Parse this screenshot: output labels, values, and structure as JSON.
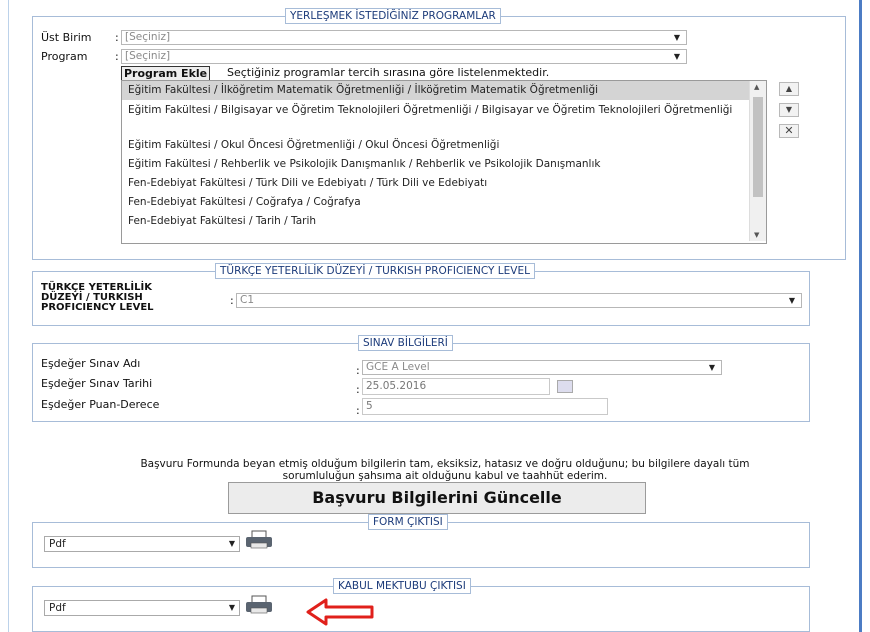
{
  "programs_section": {
    "legend": "YERLEŞMEK İSTEDİĞİNİZ PROGRAMLAR",
    "ust_birim_label": "Üst Birim",
    "ust_birim_value": "[Seçiniz]",
    "program_label": "Program",
    "program_value": "[Seçiniz]",
    "add_button": "Program Ekle",
    "note": "Seçtiğiniz programlar tercih sırasına göre listelenmektedir.",
    "items": [
      "Eğitim Fakültesi / İlköğretim Matematik Öğretmenliği / İlköğretim Matematik Öğretmenliği",
      "Eğitim Fakültesi / Bilgisayar ve Öğretim Teknolojileri Öğretmenliği / Bilgisayar ve Öğretim Teknolojileri Öğretmenliği",
      "Eğitim Fakültesi / Okul Öncesi Öğretmenliği / Okul Öncesi Öğretmenliği",
      "Eğitim Fakültesi / Rehberlik ve Psikolojik Danışmanlık / Rehberlik ve Psikolojik Danışmanlık",
      "Fen-Edebiyat Fakültesi / Türk Dili ve Edebiyatı / Türk Dili ve Edebiyatı",
      "Fen-Edebiyat Fakültesi / Coğrafya / Coğrafya",
      "Fen-Edebiyat Fakültesi / Tarih / Tarih"
    ]
  },
  "turkish_section": {
    "legend": "TÜRKÇE YETERLİLİK DÜZEYİ / TURKISH PROFICIENCY LEVEL",
    "label_line1": "TÜRKÇE YETERLİLİK",
    "label_line2": "DÜZEYİ / TURKISH",
    "label_line3": "PROFICIENCY LEVEL",
    "value": "C1"
  },
  "exam_section": {
    "legend": "SINAV BİLGİLERİ",
    "name_label": "Eşdeğer Sınav Adı",
    "name_value": "GCE A Level",
    "date_label": "Eşdeğer Sınav Tarihi",
    "date_value": "25.05.2016",
    "score_label": "Eşdeğer Puan-Derece",
    "score_value": "5"
  },
  "declaration": {
    "line1": "Başvuru Formunda beyan etmiş olduğum bilgilerin tam, eksiksiz, hatasız ve doğru olduğunu; bu bilgilere dayalı tüm",
    "line2": "sorumluluğun şahsıma ait olduğunu kabul ve taahhüt ederim.",
    "update_button": "Başvuru Bilgilerini Güncelle"
  },
  "form_output": {
    "legend": "FORM ÇIKTISI",
    "format": "Pdf"
  },
  "acceptance_output": {
    "legend": "KABUL MEKTUBU ÇIKTISI",
    "format": "Pdf"
  },
  "colors": {
    "accent": "#4c7cc4",
    "arrow": "#e0201b",
    "legend_text": "#1c3b7a"
  },
  "icons": [
    "printer-icon",
    "calendar-icon",
    "red-arrow-icon",
    "move-up-icon",
    "move-down-icon",
    "remove-icon"
  ]
}
